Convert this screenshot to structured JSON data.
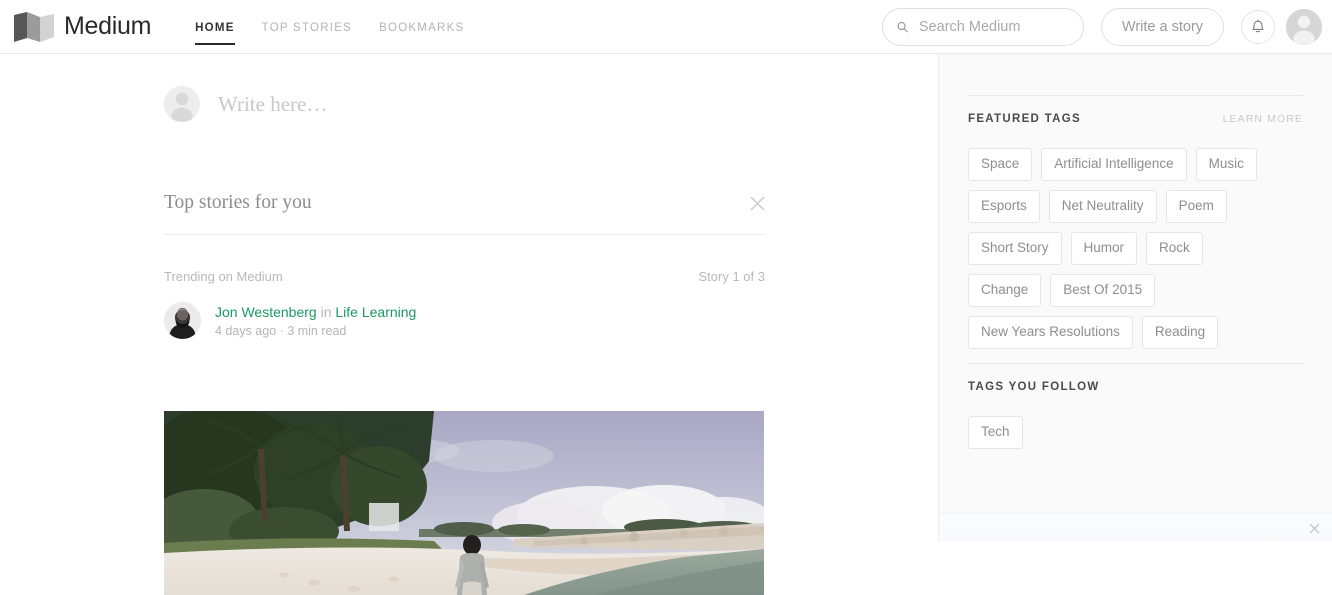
{
  "header": {
    "brand_name": "Medium",
    "logo_icon": "medium-logo-icon",
    "nav": [
      {
        "label": "HOME",
        "active": true
      },
      {
        "label": "TOP STORIES",
        "active": false
      },
      {
        "label": "BOOKMARKS",
        "active": false
      }
    ],
    "search": {
      "icon": "search-icon",
      "placeholder": "Search Medium",
      "value": ""
    },
    "write_button": "Write a story",
    "bell_icon": "notification-bell-icon",
    "avatar_icon": "user-avatar-icon"
  },
  "main": {
    "composer": {
      "avatar_icon": "user-avatar-icon",
      "placeholder": "Write here…",
      "value": ""
    },
    "section": {
      "title": "Top stories for you",
      "close_icon": "close-icon"
    },
    "story": {
      "trending_label": "Trending on Medium",
      "counter": "Story 1 of 3",
      "author": "Jon Westenberg",
      "in_word": "in",
      "publication": "Life Learning",
      "posted": "4 days ago",
      "separator": "·",
      "read_time": "3 min read",
      "author_avatar_icon": "author-photo-icon",
      "hero_image_alt": "beach-photo"
    }
  },
  "sidebar": {
    "featured": {
      "title": "FEATURED TAGS",
      "link": "LEARN MORE",
      "tags": [
        "Space",
        "Artificial Intelligence",
        "Music",
        "Esports",
        "Net Neutrality",
        "Poem",
        "Short Story",
        "Humor",
        "Rock",
        "Change",
        "Best Of 2015",
        "New Years Resolutions",
        "Reading"
      ]
    },
    "following": {
      "title": "TAGS YOU FOLLOW",
      "tags": [
        "Tech"
      ]
    },
    "bottom_panel": {
      "close_icon": "close-icon"
    }
  },
  "colors": {
    "accent_green": "#1c9963",
    "text_dark": "#333333",
    "text_muted": "#b5b5b5",
    "sidebar_bg": "#fafafa"
  }
}
